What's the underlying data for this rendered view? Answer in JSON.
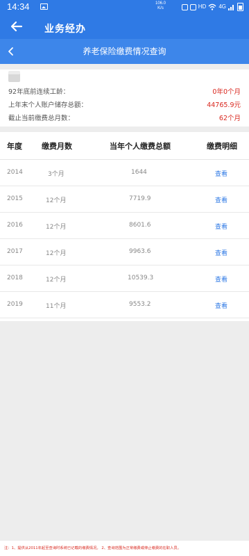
{
  "status_bar": {
    "time": "14:34",
    "net_speed_value": "106.0",
    "net_speed_unit": "K/s",
    "hd_label": "HD",
    "signal_label": "4G"
  },
  "app_bar": {
    "title": "业务经办"
  },
  "sub_bar": {
    "title": "养老保险缴费情况查询"
  },
  "summary": {
    "rows": [
      {
        "label": "92年底前连续工龄：",
        "value": "0年0个月"
      },
      {
        "label": "上年末个人账户储存总额：",
        "value": "44765.9元"
      },
      {
        "label": "截止当前缴费总月数：",
        "value": "62个月"
      }
    ]
  },
  "table": {
    "headers": [
      "年度",
      "缴费月数",
      "当年个人缴费总额",
      "缴费明细"
    ],
    "rows": [
      {
        "year": "2014",
        "months": "3个月",
        "total": "1644",
        "detail": "查看"
      },
      {
        "year": "2015",
        "months": "12个月",
        "total": "7719.9",
        "detail": "查看"
      },
      {
        "year": "2016",
        "months": "12个月",
        "total": "8601.6",
        "detail": "查看"
      },
      {
        "year": "2017",
        "months": "12个月",
        "total": "9963.6",
        "detail": "查看"
      },
      {
        "year": "2018",
        "months": "12个月",
        "total": "10539.3",
        "detail": "查看"
      },
      {
        "year": "2019",
        "months": "11个月",
        "total": "9553.2",
        "detail": "查看"
      }
    ]
  },
  "note": {
    "text": "注：1、提供从2011年起至查询时系统已记载的缴费情况。 2、查询范围为正常缴费或停止缴费的在职人员。"
  },
  "colors": {
    "primary": "#2f7ae5",
    "subbar": "#3d86ea",
    "value_red": "#d9281f",
    "link": "#2f7ae5"
  },
  "icons": [
    "image-icon",
    "back-arrow-icon",
    "chevron-left-icon",
    "card-icon",
    "wifi-icon",
    "battery-icon"
  ]
}
